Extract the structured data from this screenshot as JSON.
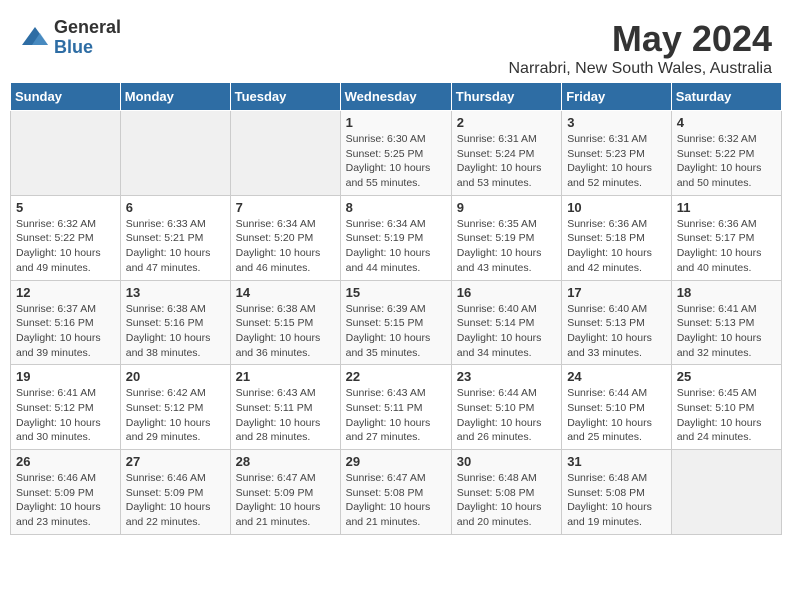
{
  "logo": {
    "general": "General",
    "blue": "Blue"
  },
  "title": "May 2024",
  "subtitle": "Narrabri, New South Wales, Australia",
  "days_header": [
    "Sunday",
    "Monday",
    "Tuesday",
    "Wednesday",
    "Thursday",
    "Friday",
    "Saturday"
  ],
  "weeks": [
    [
      {
        "num": "",
        "detail": ""
      },
      {
        "num": "",
        "detail": ""
      },
      {
        "num": "",
        "detail": ""
      },
      {
        "num": "1",
        "detail": "Sunrise: 6:30 AM\nSunset: 5:25 PM\nDaylight: 10 hours\nand 55 minutes."
      },
      {
        "num": "2",
        "detail": "Sunrise: 6:31 AM\nSunset: 5:24 PM\nDaylight: 10 hours\nand 53 minutes."
      },
      {
        "num": "3",
        "detail": "Sunrise: 6:31 AM\nSunset: 5:23 PM\nDaylight: 10 hours\nand 52 minutes."
      },
      {
        "num": "4",
        "detail": "Sunrise: 6:32 AM\nSunset: 5:22 PM\nDaylight: 10 hours\nand 50 minutes."
      }
    ],
    [
      {
        "num": "5",
        "detail": "Sunrise: 6:32 AM\nSunset: 5:22 PM\nDaylight: 10 hours\nand 49 minutes."
      },
      {
        "num": "6",
        "detail": "Sunrise: 6:33 AM\nSunset: 5:21 PM\nDaylight: 10 hours\nand 47 minutes."
      },
      {
        "num": "7",
        "detail": "Sunrise: 6:34 AM\nSunset: 5:20 PM\nDaylight: 10 hours\nand 46 minutes."
      },
      {
        "num": "8",
        "detail": "Sunrise: 6:34 AM\nSunset: 5:19 PM\nDaylight: 10 hours\nand 44 minutes."
      },
      {
        "num": "9",
        "detail": "Sunrise: 6:35 AM\nSunset: 5:19 PM\nDaylight: 10 hours\nand 43 minutes."
      },
      {
        "num": "10",
        "detail": "Sunrise: 6:36 AM\nSunset: 5:18 PM\nDaylight: 10 hours\nand 42 minutes."
      },
      {
        "num": "11",
        "detail": "Sunrise: 6:36 AM\nSunset: 5:17 PM\nDaylight: 10 hours\nand 40 minutes."
      }
    ],
    [
      {
        "num": "12",
        "detail": "Sunrise: 6:37 AM\nSunset: 5:16 PM\nDaylight: 10 hours\nand 39 minutes."
      },
      {
        "num": "13",
        "detail": "Sunrise: 6:38 AM\nSunset: 5:16 PM\nDaylight: 10 hours\nand 38 minutes."
      },
      {
        "num": "14",
        "detail": "Sunrise: 6:38 AM\nSunset: 5:15 PM\nDaylight: 10 hours\nand 36 minutes."
      },
      {
        "num": "15",
        "detail": "Sunrise: 6:39 AM\nSunset: 5:15 PM\nDaylight: 10 hours\nand 35 minutes."
      },
      {
        "num": "16",
        "detail": "Sunrise: 6:40 AM\nSunset: 5:14 PM\nDaylight: 10 hours\nand 34 minutes."
      },
      {
        "num": "17",
        "detail": "Sunrise: 6:40 AM\nSunset: 5:13 PM\nDaylight: 10 hours\nand 33 minutes."
      },
      {
        "num": "18",
        "detail": "Sunrise: 6:41 AM\nSunset: 5:13 PM\nDaylight: 10 hours\nand 32 minutes."
      }
    ],
    [
      {
        "num": "19",
        "detail": "Sunrise: 6:41 AM\nSunset: 5:12 PM\nDaylight: 10 hours\nand 30 minutes."
      },
      {
        "num": "20",
        "detail": "Sunrise: 6:42 AM\nSunset: 5:12 PM\nDaylight: 10 hours\nand 29 minutes."
      },
      {
        "num": "21",
        "detail": "Sunrise: 6:43 AM\nSunset: 5:11 PM\nDaylight: 10 hours\nand 28 minutes."
      },
      {
        "num": "22",
        "detail": "Sunrise: 6:43 AM\nSunset: 5:11 PM\nDaylight: 10 hours\nand 27 minutes."
      },
      {
        "num": "23",
        "detail": "Sunrise: 6:44 AM\nSunset: 5:10 PM\nDaylight: 10 hours\nand 26 minutes."
      },
      {
        "num": "24",
        "detail": "Sunrise: 6:44 AM\nSunset: 5:10 PM\nDaylight: 10 hours\nand 25 minutes."
      },
      {
        "num": "25",
        "detail": "Sunrise: 6:45 AM\nSunset: 5:10 PM\nDaylight: 10 hours\nand 24 minutes."
      }
    ],
    [
      {
        "num": "26",
        "detail": "Sunrise: 6:46 AM\nSunset: 5:09 PM\nDaylight: 10 hours\nand 23 minutes."
      },
      {
        "num": "27",
        "detail": "Sunrise: 6:46 AM\nSunset: 5:09 PM\nDaylight: 10 hours\nand 22 minutes."
      },
      {
        "num": "28",
        "detail": "Sunrise: 6:47 AM\nSunset: 5:09 PM\nDaylight: 10 hours\nand 21 minutes."
      },
      {
        "num": "29",
        "detail": "Sunrise: 6:47 AM\nSunset: 5:08 PM\nDaylight: 10 hours\nand 21 minutes."
      },
      {
        "num": "30",
        "detail": "Sunrise: 6:48 AM\nSunset: 5:08 PM\nDaylight: 10 hours\nand 20 minutes."
      },
      {
        "num": "31",
        "detail": "Sunrise: 6:48 AM\nSunset: 5:08 PM\nDaylight: 10 hours\nand 19 minutes."
      },
      {
        "num": "",
        "detail": ""
      }
    ]
  ]
}
